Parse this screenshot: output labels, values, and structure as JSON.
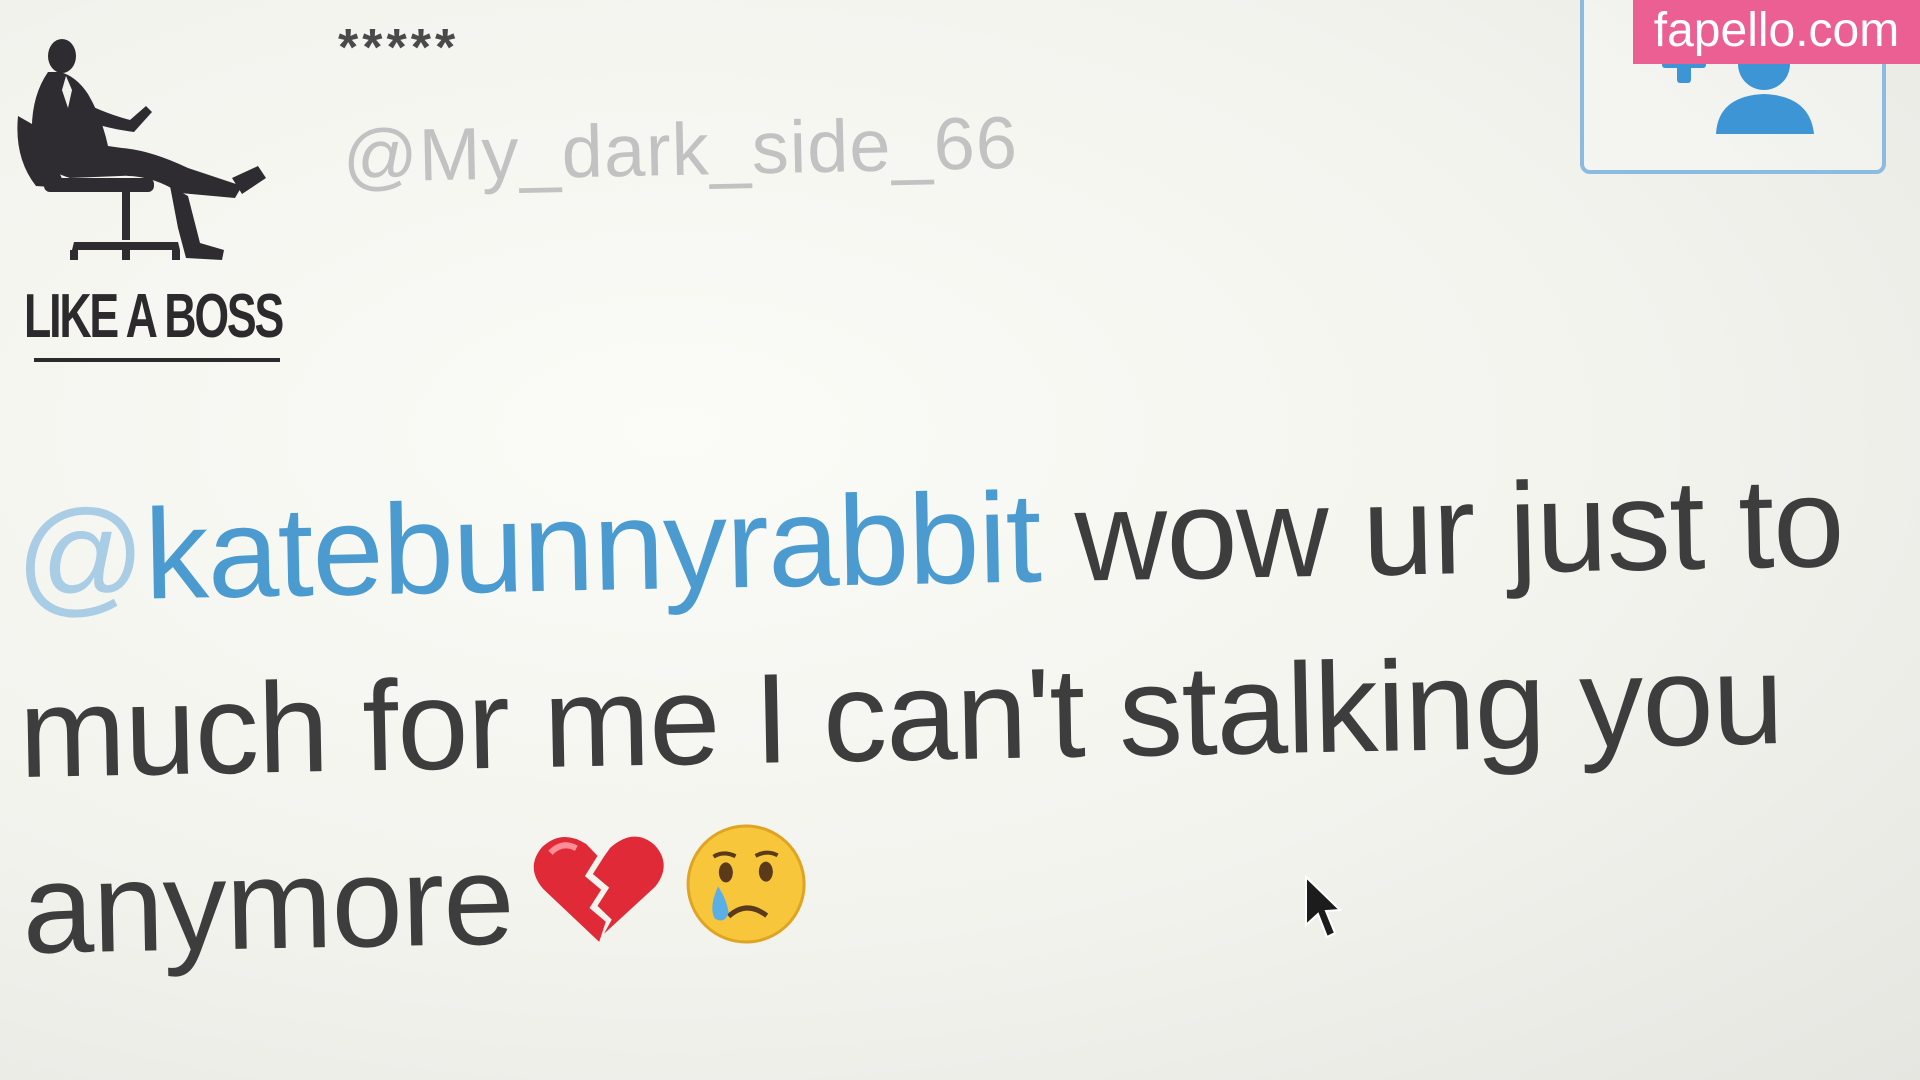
{
  "tweet": {
    "display_name": "*****",
    "username": "@My_dark_side_66",
    "avatar": {
      "caption": "LIKE A BOSS",
      "icon": "boss-in-chair-icon"
    },
    "follow_button_icon": "follow-user-icon",
    "mention_at": "@",
    "mention_handle": "katebunnyrabbit",
    "text_line1": " wow ur just to",
    "text_line2": "much for me I can't stalking you",
    "text_line3": "anymore",
    "emojis": [
      "broken-heart-icon",
      "crying-face-icon"
    ]
  },
  "watermark": {
    "text": "fapello.com"
  },
  "colors": {
    "mention": "#4b9bd0",
    "text": "#3d3d3d",
    "username": "#c2c2c2",
    "watermark_bg": "#ec5f93",
    "follow_border": "#8cbbdf"
  }
}
